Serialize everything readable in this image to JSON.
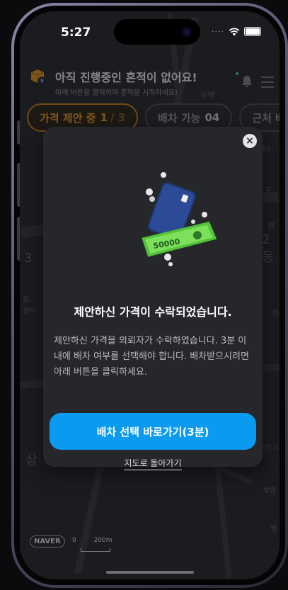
{
  "status_bar": {
    "time": "5:27",
    "signal": "····"
  },
  "header": {
    "title": "아직 진행중인 혼적이 없어요!",
    "subtitle": "아래 버튼을 클릭하여 혼적을 시작하세요!"
  },
  "chips": [
    {
      "label": "가격 제안 중",
      "count": "1",
      "total": "/ 3"
    },
    {
      "label": "배차 가능",
      "count": "04"
    },
    {
      "label": "근처 배차"
    }
  ],
  "modal": {
    "close_icon": "×",
    "illustration_text": "50000",
    "title": "제안하신 가격이 수락되었습니다.",
    "description": "제안하신 가격을 의뢰자가 수락하였습니다. 3분 이내에 배차 여부를 선택해야 합니다. 배차받으시려면 아래 버튼을 클릭하세요.",
    "primary_button": "배차 선택 바로가기(3분)",
    "secondary_link": "지도로 돌아가기"
  },
  "map": {
    "labels": [
      "수역",
      "터",
      "교",
      "원",
      "2동",
      "가",
      "3",
      "동",
      "센터",
      "삼",
      "부천시",
      "부원",
      "행"
    ],
    "naver_badge": "NAVER",
    "scale_start": "0",
    "scale_end": "200m"
  },
  "colors": {
    "accent_orange": "#d99028",
    "primary_blue": "#0a9bf0",
    "modal_bg": "#26272b"
  },
  "icons": [
    "box-icon",
    "bell-icon",
    "menu-icon",
    "close-icon",
    "card-icon",
    "money-icon",
    "wifi-icon",
    "battery-icon"
  ]
}
